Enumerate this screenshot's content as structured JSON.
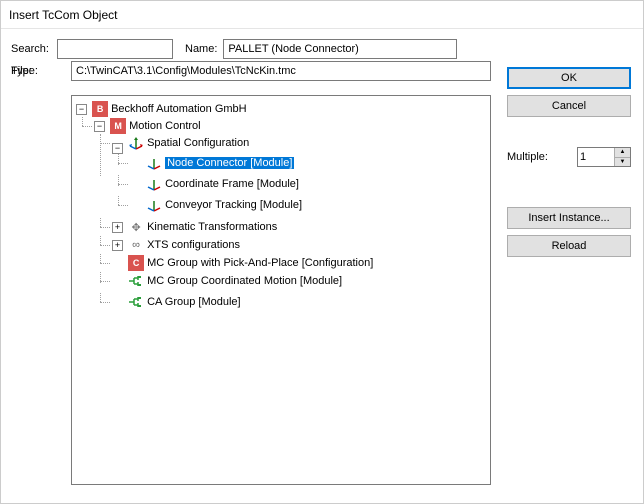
{
  "window": {
    "title": "Insert TcCom Object"
  },
  "labels": {
    "search": "Search:",
    "name": "Name:",
    "type": "Type:",
    "file": "File:",
    "multiple": "Multiple:"
  },
  "fields": {
    "search": "",
    "name": "PALLET (Node Connector)",
    "file": "C:\\TwinCAT\\3.1\\Config\\Modules\\TcNcKin.tmc",
    "multiple": "1"
  },
  "buttons": {
    "ok": "OK",
    "cancel": "Cancel",
    "insert_instance": "Insert Instance...",
    "reload": "Reload"
  },
  "tree": {
    "root": "Beckhoff Automation GmbH",
    "motion": "Motion Control",
    "spatial": "Spatial Configuration",
    "node_connector": "Node Connector [Module]",
    "coord_frame": "Coordinate Frame [Module]",
    "conveyor": "Conveyor Tracking [Module]",
    "kinematic": "Kinematic Transformations",
    "xts": "XTS configurations",
    "pick_place": "MC Group with Pick-And-Place [Configuration]",
    "coord_motion": "MC Group Coordinated Motion [Module]",
    "ca_group": "CA Group [Module]"
  }
}
